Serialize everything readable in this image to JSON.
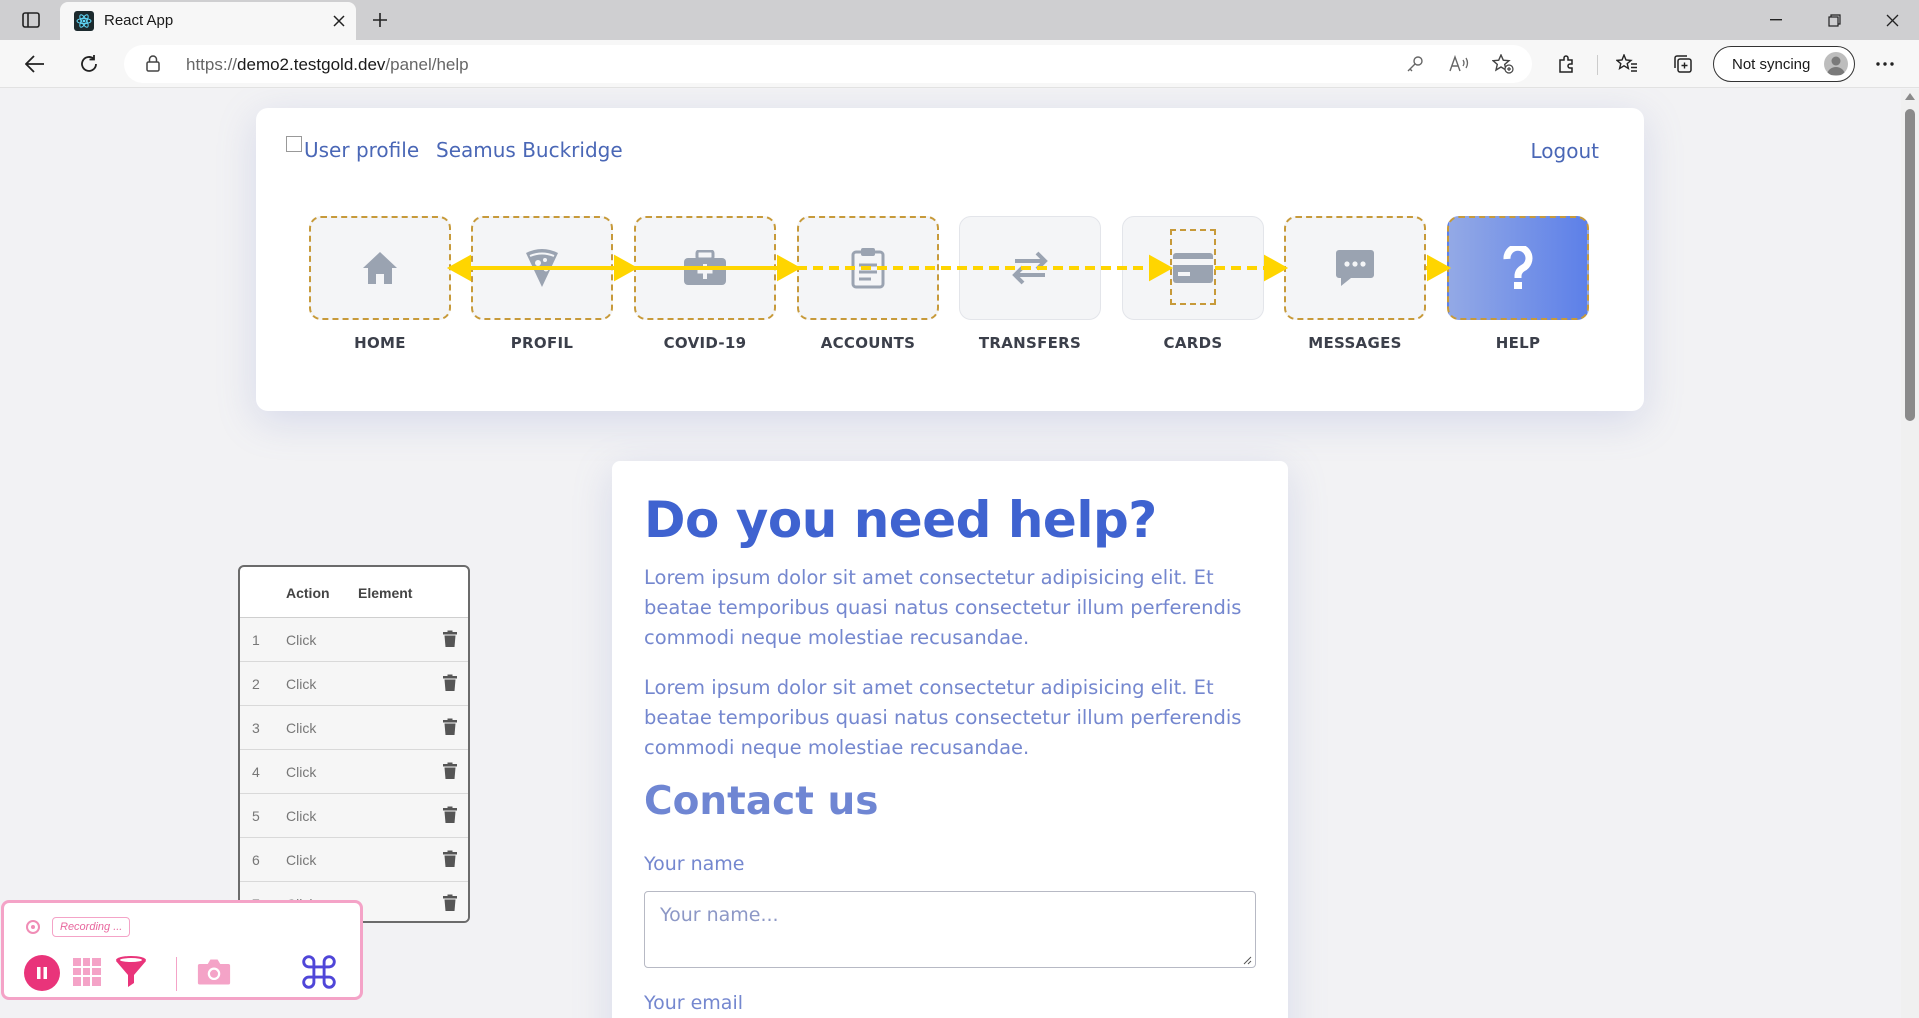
{
  "browser": {
    "tab_title": "React App",
    "url_prefix": "https://",
    "url_host": "demo2.testgold.dev",
    "url_path": "/panel/help",
    "sync_label": "Not syncing"
  },
  "header": {
    "profile_alt": "User profile",
    "user_name": "Seamus Buckridge",
    "logout_label": "Logout"
  },
  "nav": {
    "items": [
      {
        "label": "HOME",
        "icon": "home-icon"
      },
      {
        "label": "PROFIL",
        "icon": "pizza-icon"
      },
      {
        "label": "COVID-19",
        "icon": "medkit-icon"
      },
      {
        "label": "ACCOUNTS",
        "icon": "clipboard-icon"
      },
      {
        "label": "TRANSFERS",
        "icon": "transfer-arrows-icon"
      },
      {
        "label": "CARDS",
        "icon": "credit-card-icon"
      },
      {
        "label": "MESSAGES",
        "icon": "message-icon"
      },
      {
        "label": "HELP",
        "icon": "question-icon"
      }
    ],
    "active": "HELP",
    "flow_color": "#ffd500",
    "tile_border_color": "#c79a3a"
  },
  "help": {
    "title": "Do you need help?",
    "paragraph1": "Lorem ipsum dolor sit amet consectetur adipisicing elit. Et beatae temporibus quasi natus consectetur illum perferendis commodi neque molestiae recusandae.",
    "paragraph2": "Lorem ipsum dolor sit amet consectetur adipisicing elit. Et beatae temporibus quasi natus consectetur illum perferendis commodi neque molestiae recusandae.",
    "contact_title": "Contact us",
    "name_label": "Your name",
    "name_placeholder": "Your name...",
    "email_label": "Your email",
    "accent": "#3f63d0"
  },
  "recorder": {
    "col_action": "Action",
    "col_element": "Element",
    "rows": [
      {
        "num": "1",
        "action": "Click"
      },
      {
        "num": "2",
        "action": "Click"
      },
      {
        "num": "3",
        "action": "Click"
      },
      {
        "num": "4",
        "action": "Click"
      },
      {
        "num": "5",
        "action": "Click"
      },
      {
        "num": "6",
        "action": "Click"
      },
      {
        "num": "7",
        "action": "Click"
      }
    ],
    "status": "Recording ...",
    "accent": "#e9347a"
  }
}
